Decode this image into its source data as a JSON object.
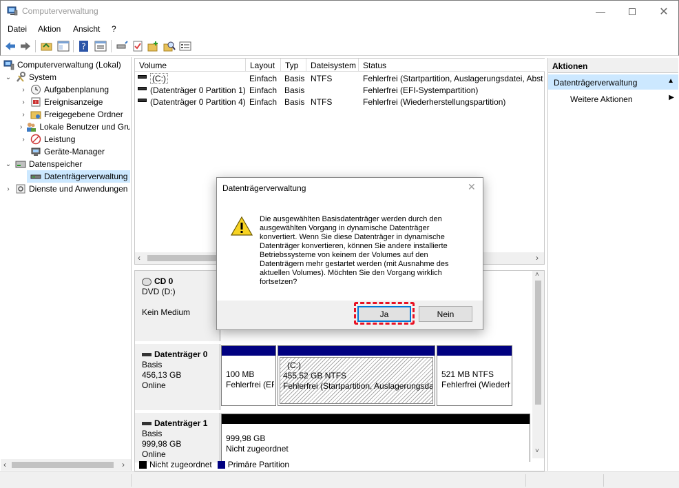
{
  "window": {
    "title": "Computerverwaltung"
  },
  "menu": [
    "Datei",
    "Aktion",
    "Ansicht",
    "?"
  ],
  "tree": {
    "root": "Computerverwaltung (Lokal)",
    "system": "System",
    "aufgaben": "Aufgabenplanung",
    "ereignis": "Ereignisanzeige",
    "ordner": "Freigegebene Ordner",
    "benutzer": "Lokale Benutzer und Gruppen",
    "leistung": "Leistung",
    "geraete": "Geräte-Manager",
    "speicher": "Datenspeicher",
    "dtv": "Datenträgerverwaltung",
    "dienste": "Dienste und Anwendungen"
  },
  "volumes": {
    "headers": [
      "Volume",
      "Layout",
      "Typ",
      "Dateisystem",
      "Status"
    ],
    "rows": [
      [
        "(C:)",
        "Einfach",
        "Basis",
        "NTFS",
        "Fehlerfrei (Startpartition, Auslagerungsdatei, Absturzabbild, Primäre Partition)"
      ],
      [
        "(Datenträger 0 Partition 1)",
        "Einfach",
        "Basis",
        "",
        "Fehlerfrei (EFI-Systempartition)"
      ],
      [
        "(Datenträger 0 Partition 4)",
        "Einfach",
        "Basis",
        "NTFS",
        "Fehlerfrei (Wiederherstellungspartition)"
      ]
    ]
  },
  "disks": {
    "cd": {
      "name": "CD 0",
      "type": "DVD (D:)",
      "status": "Kein Medium"
    },
    "d0": {
      "name": "Datenträger 0",
      "type": "Basis",
      "size": "456,13 GB",
      "status": "Online",
      "p1_size": "100 MB",
      "p1_status": "Fehlerfrei (EFI-Systempartition)",
      "p2_name": "(C:)",
      "p2_size": "455,52 GB NTFS",
      "p2_status": "Fehlerfrei (Startpartition, Auslagerungsdatei)",
      "p3_size": "521 MB NTFS",
      "p3_status": "Fehlerfrei (Wiederherstellungspartition)"
    },
    "d1": {
      "name": "Datenträger 1",
      "type": "Basis",
      "size": "999,98 GB",
      "status": "Online",
      "p1_size": "999,98 GB",
      "p1_status": "Nicht zugeordnet"
    }
  },
  "legend": {
    "unalloc": "Nicht zugeordnet",
    "primary": "Primäre Partition"
  },
  "actions": {
    "title": "Aktionen",
    "section": "Datenträgerverwaltung",
    "more": "Weitere Aktionen"
  },
  "dialog": {
    "title": "Datenträgerverwaltung",
    "message": "Die ausgewählten Basisdatenträger werden durch den ausgewählten Vorgang in dynamische Datenträger konvertiert. Wenn Sie diese Datenträger in dynamische Datenträger konvertieren, können Sie andere installierte Betriebssysteme von keinem der Volumes auf den Datenträgern mehr gestartet werden (mit Ausnahme des aktuellen Volumes). Möchten Sie den Vorgang wirklich fortsetzen?",
    "yes": "Ja",
    "no": "Nein"
  },
  "colors": {
    "primary_partition": "#000080",
    "unallocated": "#000000",
    "highlight": "#e81123",
    "selection": "#cce8ff"
  }
}
